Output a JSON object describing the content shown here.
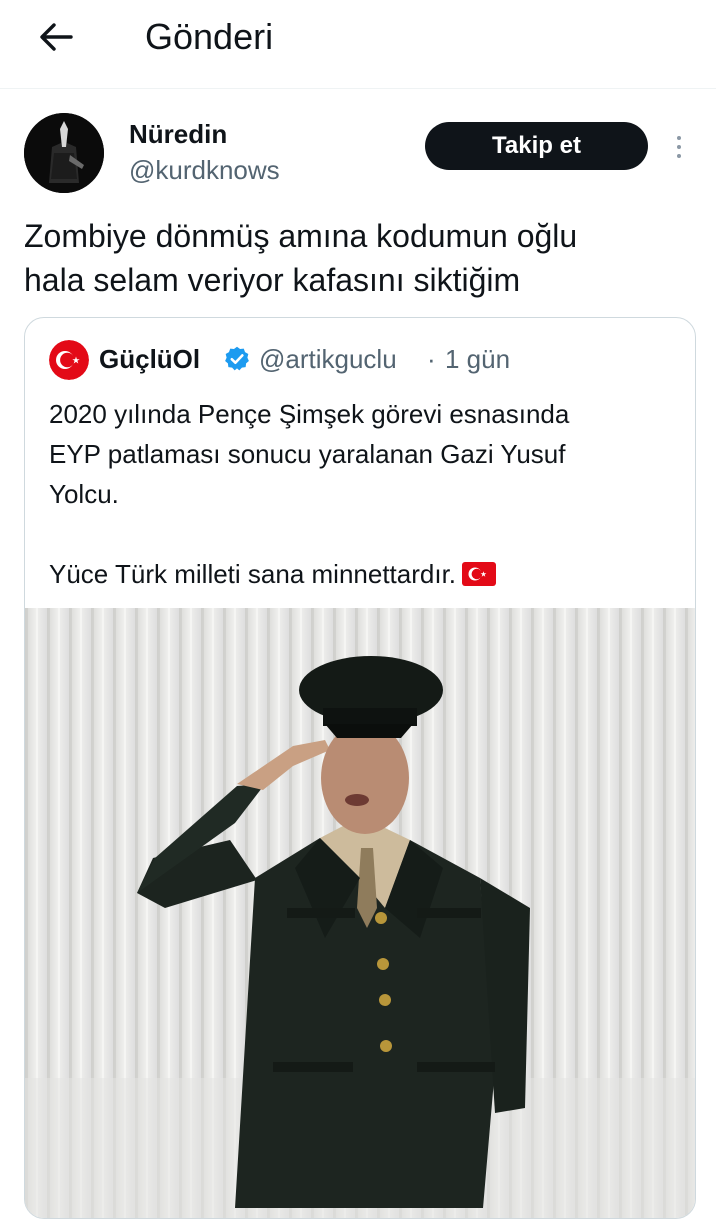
{
  "header": {
    "title": "Gönderi",
    "back_icon": "arrow-left-icon"
  },
  "post": {
    "author_name": "Nüredin",
    "author_handle": "@kurdknows",
    "follow_label": "Takip et",
    "more_icon": "more-vertical-icon",
    "text_line1": "Zombiye dönmüş amına kodumun oğlu",
    "text_line2": "hala selam veriyor kafasını siktiğim"
  },
  "quote": {
    "name": "GüçlüOl",
    "verified_icon": "verified-badge-icon",
    "handle": "@artikguclu",
    "separator": "·",
    "time": "1 gün",
    "text_line1": "2020 yılında Pençe Şimşek görevi esnasında",
    "text_line2": "EYP patlaması sonucu yaralanan Gazi Yusuf",
    "text_line3": "Yolcu.",
    "text_line4": "Yüce Türk milleti sana minnettardır.",
    "flag_icon": "turkey-flag-icon"
  },
  "colors": {
    "text": "#0f1419",
    "secondary": "#536471",
    "border": "#cfd9de",
    "button_bg": "#0f1419",
    "verified": "#1d9bf0",
    "flag_red": "#e30a17"
  }
}
